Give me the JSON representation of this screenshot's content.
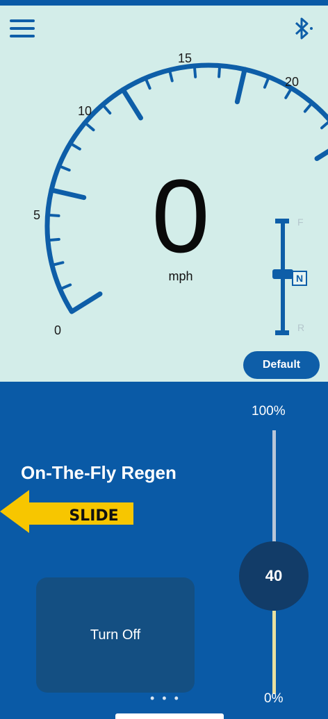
{
  "header": {
    "menu_icon": "hamburger-menu-icon",
    "bluetooth_icon": "bluetooth-icon"
  },
  "gauge": {
    "tick_labels": [
      "0",
      "5",
      "10",
      "15",
      "20"
    ],
    "range": [
      0,
      20
    ],
    "speed": "0",
    "unit": "mph",
    "needle_color": "#0e5ea8"
  },
  "gear_selector": {
    "forward": "F",
    "neutral": "N",
    "reverse": "R",
    "selected": "N"
  },
  "default_button": "Default",
  "regen": {
    "title": "On-The-Fly Regen",
    "top_label": "100%",
    "bottom_label": "0%",
    "value": "40"
  },
  "annotation": {
    "slide_label": "SLIDE",
    "arrow_color": "#f7c600"
  },
  "turn_off_button": "Turn Off",
  "pager": {
    "dots": "• • •"
  },
  "colors": {
    "panel_background": "#d3ede9",
    "control_background": "#0a5aa6",
    "accent": "#0e5ea8"
  }
}
